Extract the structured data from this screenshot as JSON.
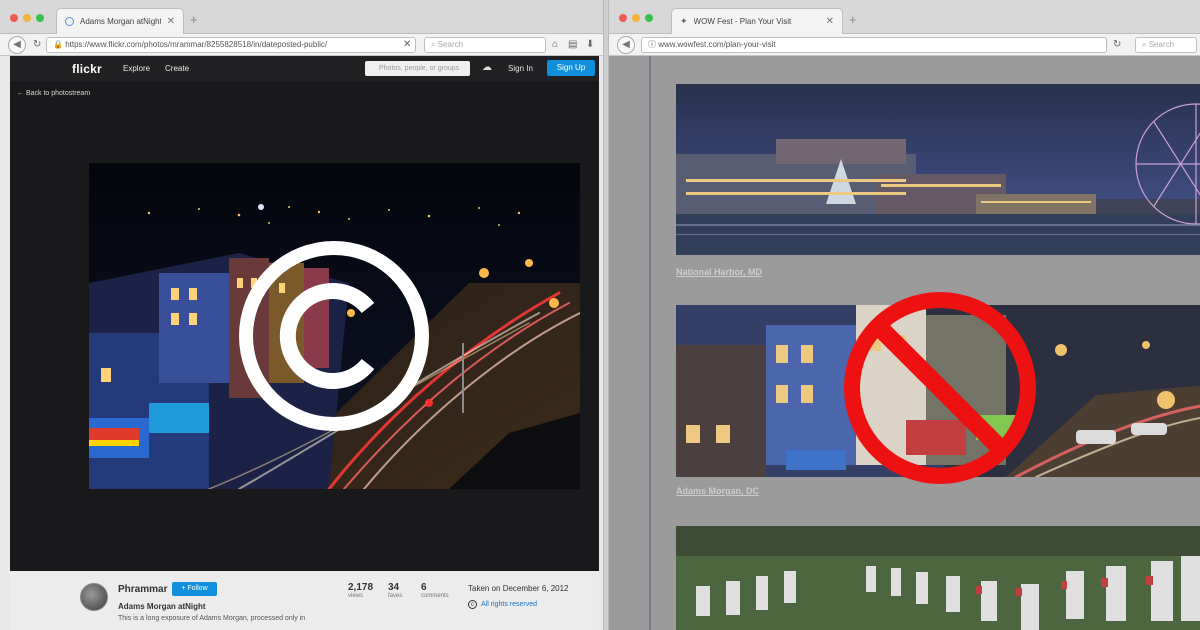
{
  "left_browser": {
    "tab_title": "Adams Morgan atNight | Fli...",
    "url": "https://www.flickr.com/photos/mrammar/8255828518/in/dateposted-public/",
    "search_placeholder": "Search",
    "flickr": {
      "logo": "flickr",
      "nav": [
        "Explore",
        "Create"
      ],
      "search_placeholder": "Photos, people, or groups",
      "sign_in": "Sign In",
      "sign_up": "Sign Up",
      "back_link": "Back to photostream",
      "author": "Phrammar",
      "follow_label": "+ Follow",
      "photo_title": "Adams Morgan atNight",
      "photo_description": "This is a long exposure of Adams Morgan, processed only in",
      "stats": [
        {
          "value": "2,178",
          "label": "views"
        },
        {
          "value": "34",
          "label": "faves"
        },
        {
          "value": "6",
          "label": "comments"
        }
      ],
      "taken_on": "Taken on December 6, 2012",
      "rights": "All rights reserved"
    }
  },
  "right_browser": {
    "tab_title": "WOW Fest - Plan Your Visit",
    "url": "www.wowfest.com/plan-your-visit",
    "search_placeholder": "Search",
    "captions": [
      "National Harbor, MD",
      "Adams Morgan, DC"
    ]
  },
  "colors": {
    "flickr_bg": "#19191b",
    "flickr_blue": "#128fdc",
    "no_sign_red": "#ee1111",
    "copyright_white": "#ffffff"
  }
}
